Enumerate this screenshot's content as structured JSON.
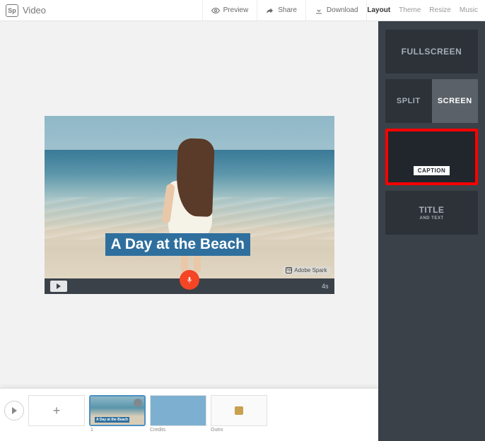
{
  "app": {
    "logo_text": "Sp",
    "title": "Video"
  },
  "header_actions": {
    "preview": "Preview",
    "share": "Share",
    "download": "Download"
  },
  "menu_tabs": {
    "layout": "Layout",
    "theme": "Theme",
    "resize": "Resize",
    "music": "Music"
  },
  "stage": {
    "caption_text": "A Day at the Beach",
    "watermark": "Adobe Spark",
    "watermark_logo": "Sp",
    "duration": "4s"
  },
  "layouts": {
    "fullscreen": "FULLSCREEN",
    "split_left": "SPLIT",
    "split_right": "SCREEN",
    "caption": "CAPTION",
    "title_main": "TITLE",
    "title_sub": "AND TEXT"
  },
  "timeline": {
    "add_label": "+",
    "clips": [
      {
        "num": "1",
        "caption": "A Day at the Beach",
        "label": ""
      },
      {
        "num": "",
        "caption": "",
        "label": "Credits"
      },
      {
        "num": "",
        "caption": "",
        "label": "Outro"
      }
    ]
  }
}
